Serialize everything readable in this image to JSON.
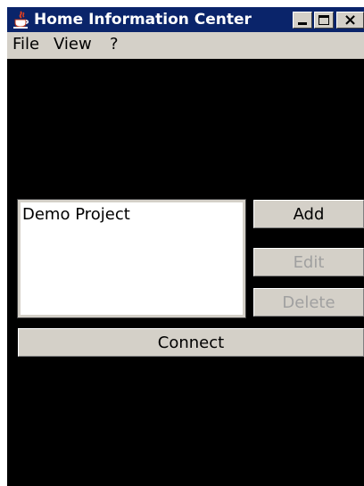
{
  "window": {
    "title": "Home Information Center",
    "icon": "java-cup-icon"
  },
  "menubar": {
    "file": "File",
    "view": "View",
    "help": "?"
  },
  "projects": {
    "items": [
      "Demo Project"
    ]
  },
  "buttons": {
    "add": "Add",
    "edit": "Edit",
    "delete": "Delete",
    "connect": "Connect"
  },
  "colors": {
    "titlebar": "#0a246a",
    "chrome": "#d4d0c8",
    "background": "#000000",
    "disabled_text": "#a0a0a0"
  }
}
